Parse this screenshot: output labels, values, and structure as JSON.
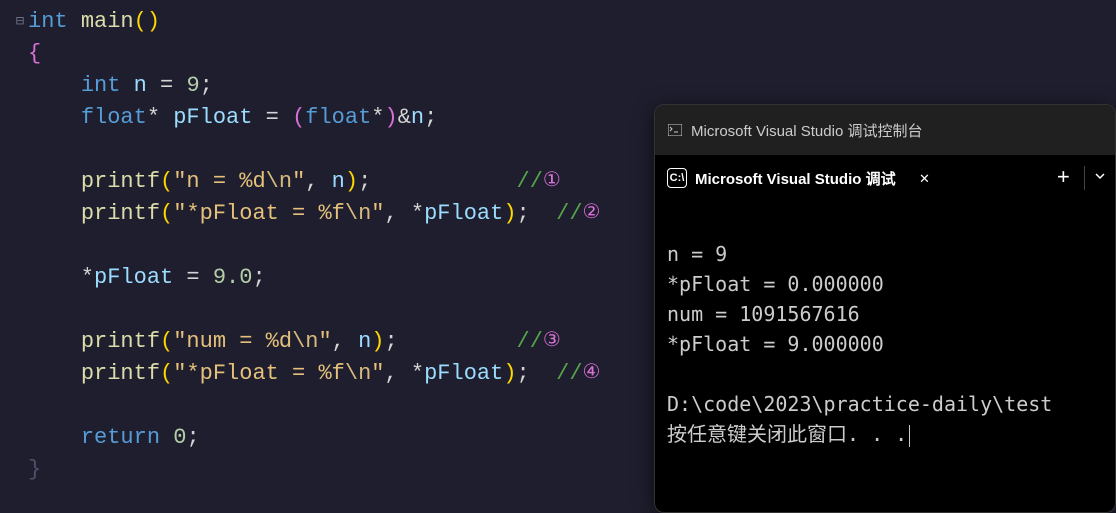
{
  "code": {
    "kw_int": "int",
    "kw_float": "float",
    "kw_return": "return",
    "fn_main": "main",
    "fn_printf": "printf",
    "var_n": "n",
    "var_pFloat": "pFloat",
    "num_9": "9",
    "num_9f": "9.0",
    "num_0": "0",
    "str1_a": "\"n = %d",
    "str1_b": "\"",
    "nl_esc": "\\n",
    "str2_a": "\"*pFloat = %f",
    "str3_a": "\"num = %d",
    "str4_a": "\"*pFloat = %f",
    "comment_slash": "//",
    "c1": "①",
    "c2": "②",
    "c3": "③",
    "c4": "④",
    "fold_icon": "⊟"
  },
  "term": {
    "windowTitle": "Microsoft Visual Studio 调试控制台",
    "tabTitle": "Microsoft Visual Studio 调试",
    "tabIcon": "C:\\",
    "lines": {
      "l1": "n = 9",
      "l2": "*pFloat = 0.000000",
      "l3": "num = 1091567616",
      "l4": "*pFloat = 9.000000",
      "l5": "",
      "l6": "D:\\code\\2023\\practice-daily\\test",
      "l7": "按任意键关闭此窗口. . ."
    }
  }
}
